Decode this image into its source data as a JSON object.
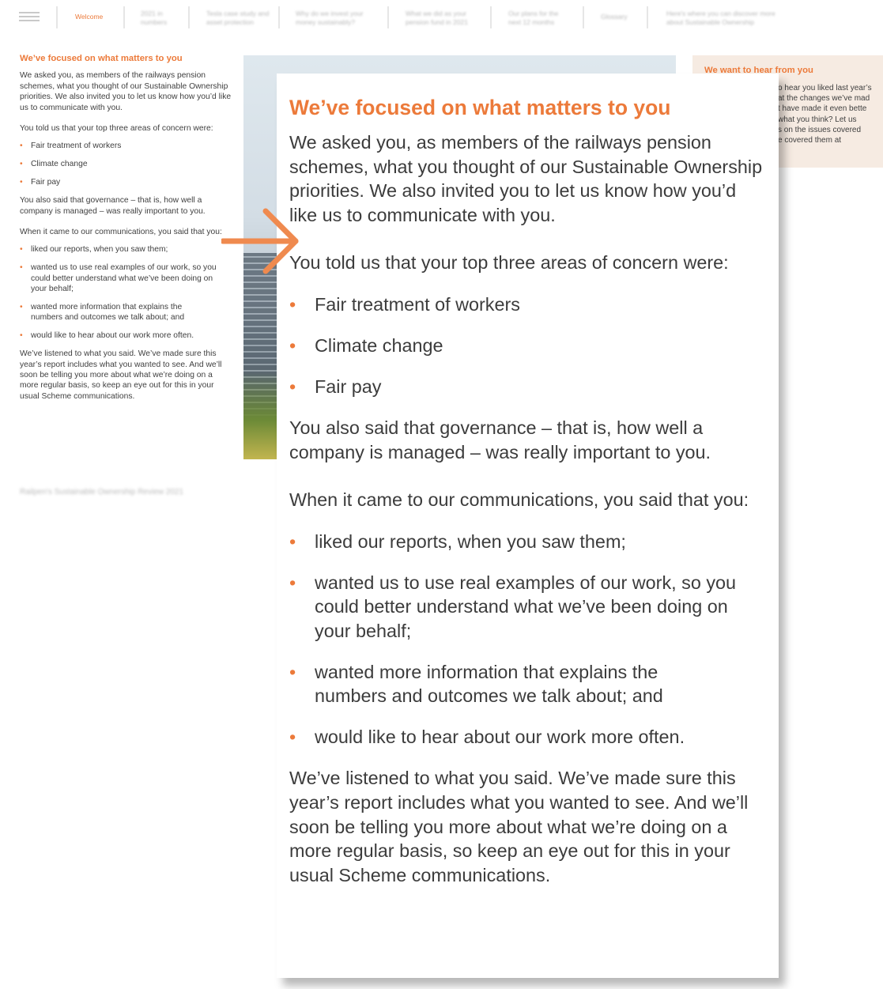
{
  "nav": {
    "items": [
      {
        "label": "Welcome",
        "active": true
      },
      {
        "label": "2021 in numbers",
        "active": false
      },
      {
        "label": "Tesla case study and asset protection",
        "active": false
      },
      {
        "label": "Why do we invest your money sustainably?",
        "active": false
      },
      {
        "label": "What we did as your pension fund in 2021",
        "active": false
      },
      {
        "label": "Our plans for the next 12 months",
        "active": false
      },
      {
        "label": "Glossary",
        "active": false
      },
      {
        "label": "Here's where you can discover more about Sustainable Ownership",
        "active": false
      }
    ]
  },
  "article": {
    "title": "We’ve focused on what matters to you",
    "intro": "We asked you, as members of the railways pension schemes, what you thought of our Sustainable Ownership priorities. We also invited you to let us know how you’d like us to communicate with you.",
    "concerns_intro": "You told us that your top three areas of concern were:",
    "concerns": [
      "Fair treatment of workers",
      "Climate change",
      "Fair pay"
    ],
    "governance": "You also said that governance – that is, how well a company is managed – was really important to you.",
    "comms_intro": "When it came to our communications, you said that you:",
    "comms": [
      "liked our reports, when you saw them;",
      "wanted us to use real examples of our work, so you could better understand what we’ve been doing on your behalf;",
      "wanted more information that explains the numbers and outcomes we talk about; and",
      "would like to hear about our work more often."
    ],
    "closing": "We’ve listened to what you said. We’ve made sure this year’s report includes what you wanted to see. And we’ll soon be telling you more about what we’re doing on a more regular basis, so keep an eye out for this in your usual Scheme communications."
  },
  "left_page": {
    "title": "We’ve focused on what matters to you",
    "intro": "We asked you, as members of the railways pension schemes, what you thought of our Sustainable Ownership priorities. We also invited you to let us know how you’d like us to communicate with you.",
    "concerns_intro": "You told us that your top three areas of concern were:",
    "concerns": [
      "Fair treatment of workers",
      "Climate change",
      "Fair pay"
    ],
    "governance": "You also said that governance – that is, how well a company is managed – was really important to you.",
    "comms_intro": "When it came to our communications, you said that you:",
    "comms": [
      "liked our reports, when you saw them;",
      "wanted us to use real examples of our work, so you could better understand what we’ve been doing on your behalf;",
      "wanted more information that explains the numbers and outcomes we talk about; and",
      "would like to hear about our work more often."
    ],
    "closing": "We’ve listened to what you said. We’ve made sure this year’s report includes what you wanted to see. And we’ll soon be telling you more about what we’re doing on a more regular basis, so keep an eye out for this in your usual Scheme communications.",
    "footer": "Railpen's Sustainable Ownership Review 2021"
  },
  "right_card": {
    "title": "We want to hear from you",
    "lines": [
      "o hear you liked last year’s",
      "at the changes we’ve mad",
      "t have made it even bette",
      " what you think? Let us",
      "s on the issues covered",
      "e covered them at"
    ]
  },
  "colors": {
    "accent": "#ec7a3a",
    "text": "#3c3c3c",
    "card_bg": "#f6ebe2"
  },
  "icons": {
    "menu": "hamburger-icon",
    "arrow": "arrow-right-icon"
  }
}
